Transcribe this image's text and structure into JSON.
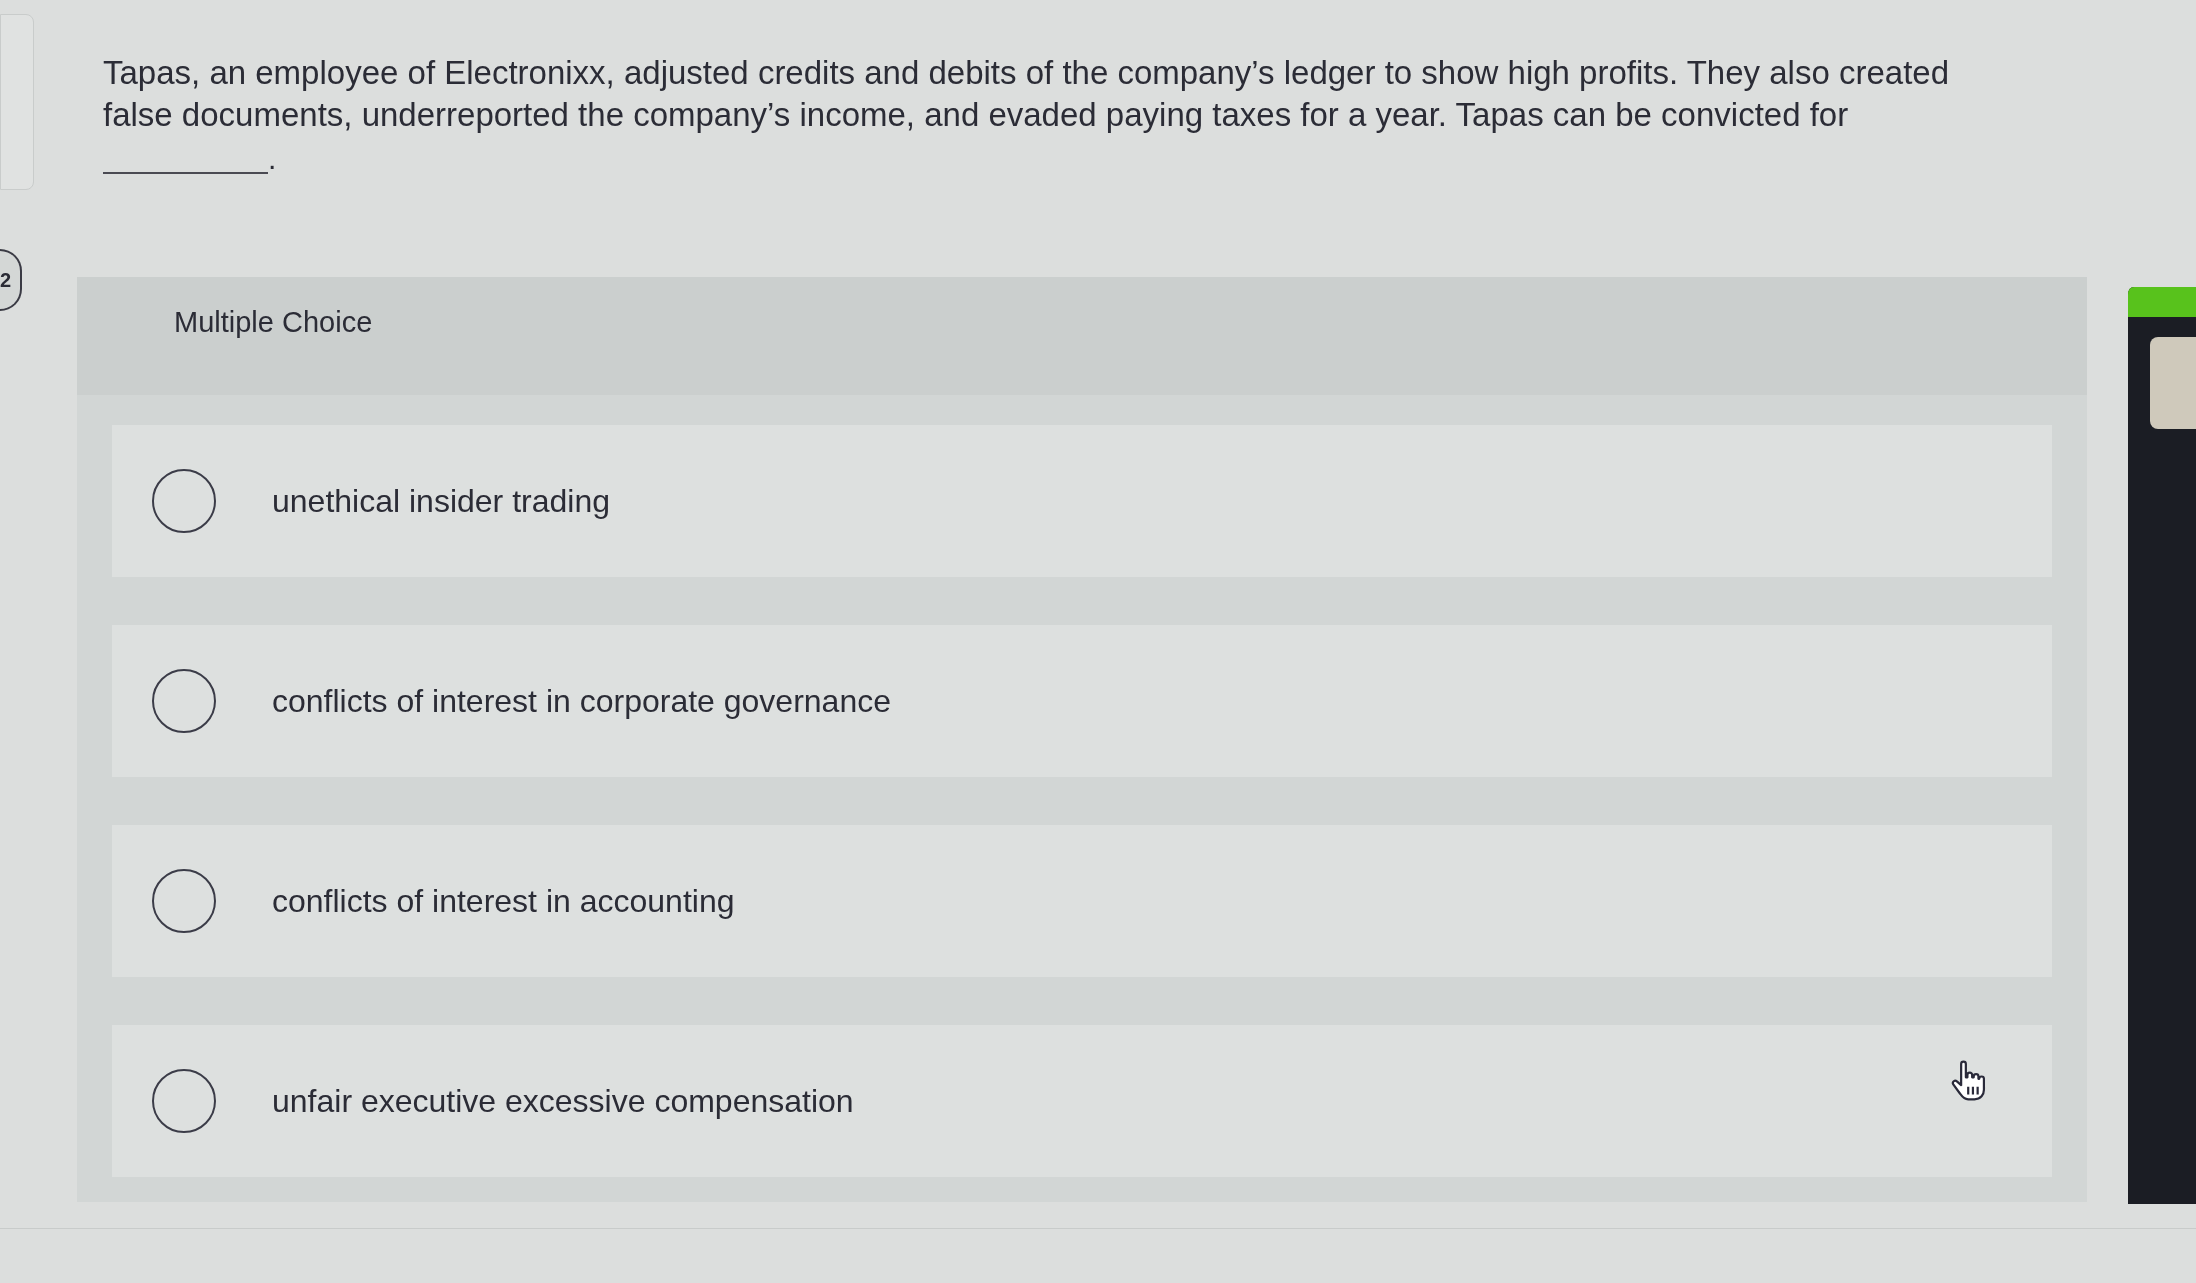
{
  "question": {
    "number": "2",
    "text": "Tapas, an employee of Electronixx, adjusted credits and debits of the company’s ledger to show high profits. They also created false documents, underreported the company’s income, and evaded paying taxes for a year. Tapas can be convicted for",
    "blank_end": "."
  },
  "multiple_choice": {
    "heading": "Multiple Choice",
    "options": [
      {
        "label": "unethical insider trading",
        "selected": false
      },
      {
        "label": "conflicts of interest in corporate governance",
        "selected": false
      },
      {
        "label": "conflicts of interest in accounting",
        "selected": false
      },
      {
        "label": "unfair executive excessive compensation",
        "selected": false
      }
    ]
  }
}
